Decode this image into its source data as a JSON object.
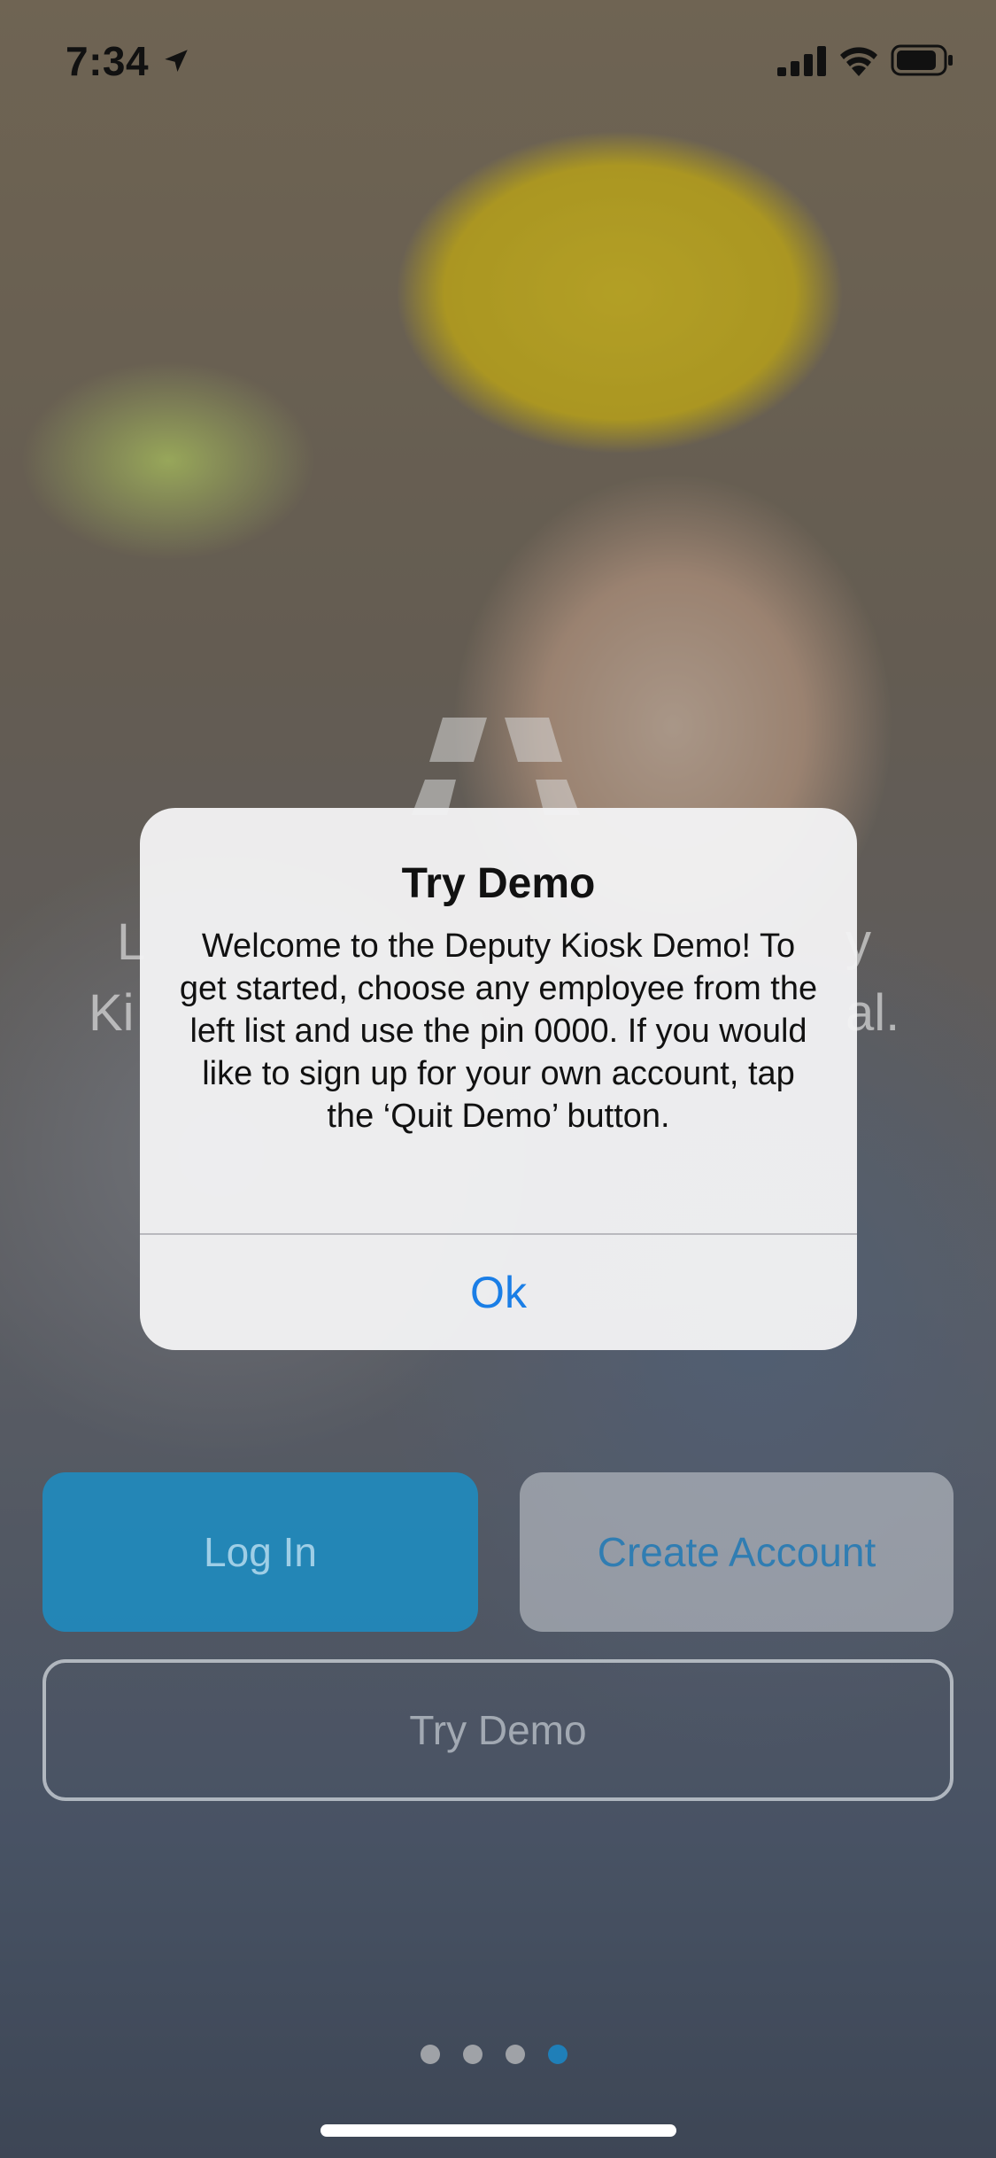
{
  "status_bar": {
    "time": "7:34",
    "icons": [
      "location-arrow-icon",
      "cellular-signal-icon",
      "wifi-icon",
      "battery-icon"
    ]
  },
  "background": {
    "logo_icon": "deputy-logo-icon",
    "partial_text": {
      "line1_left": "L",
      "line2_left": "Ki",
      "line1_right": "y",
      "line2_right": "al."
    }
  },
  "buttons": {
    "login": "Log In",
    "create_account": "Create Account",
    "try_demo": "Try Demo"
  },
  "pager": {
    "total": 4,
    "active_index": 3
  },
  "alert": {
    "title": "Try Demo",
    "message": "Welcome to the Deputy Kiosk Demo! To get started, choose any employee from the left list and use the pin 0000. If you would like to sign up for your own account, tap the ‘Quit Demo’ button.",
    "ok_label": "Ok"
  },
  "colors": {
    "accent_blue": "#1a7ee6",
    "login_button": "#1496d2",
    "active_dot": "#1f7fb8"
  }
}
